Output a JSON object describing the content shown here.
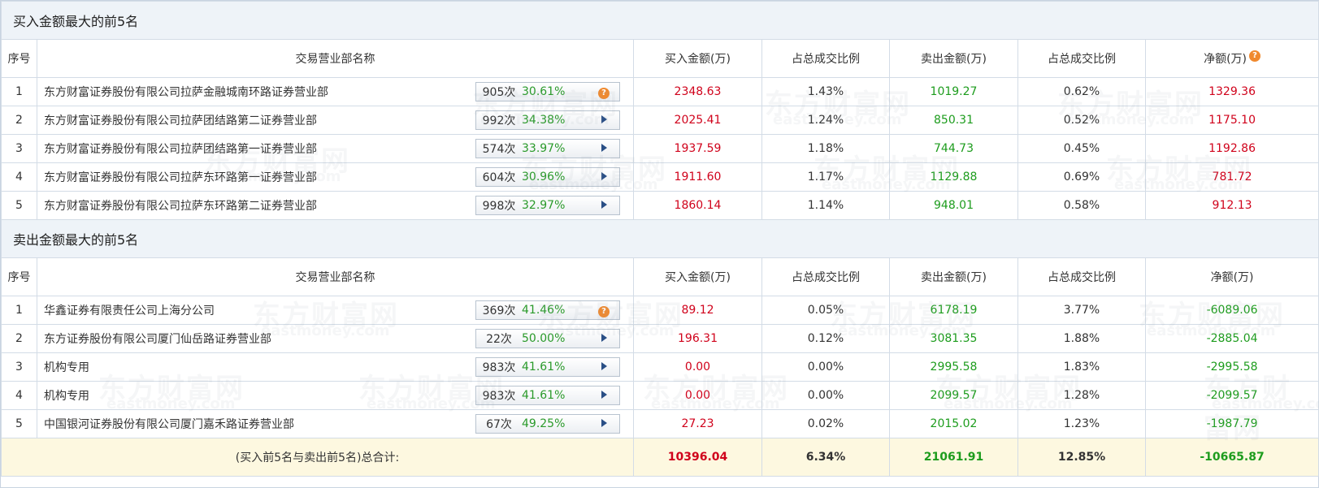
{
  "buy_section": {
    "title": "买入金额最大的前5名",
    "headers": [
      "序号",
      "交易营业部名称",
      "买入金额(万)",
      "占总成交比例",
      "卖出金额(万)",
      "占总成交比例",
      "净额(万)"
    ],
    "rows": [
      {
        "seq": "1",
        "name": "东方财富证券股份有限公司拉萨金融城南环路证券营业部",
        "count": "905次",
        "pct": "30.61%",
        "icon": "question-icon",
        "buy": "2348.63",
        "buy_ratio": "1.43%",
        "sell": "1019.27",
        "sell_ratio": "0.62%",
        "net": "1329.36"
      },
      {
        "seq": "2",
        "name": "东方财富证券股份有限公司拉萨团结路第二证券营业部",
        "count": "992次",
        "pct": "34.38%",
        "icon": "arrow-icon",
        "buy": "2025.41",
        "buy_ratio": "1.24%",
        "sell": "850.31",
        "sell_ratio": "0.52%",
        "net": "1175.10"
      },
      {
        "seq": "3",
        "name": "东方财富证券股份有限公司拉萨团结路第一证券营业部",
        "count": "574次",
        "pct": "33.97%",
        "icon": "arrow-icon",
        "buy": "1937.59",
        "buy_ratio": "1.18%",
        "sell": "744.73",
        "sell_ratio": "0.45%",
        "net": "1192.86"
      },
      {
        "seq": "4",
        "name": "东方财富证券股份有限公司拉萨东环路第一证券营业部",
        "count": "604次",
        "pct": "30.96%",
        "icon": "arrow-icon",
        "buy": "1911.60",
        "buy_ratio": "1.17%",
        "sell": "1129.88",
        "sell_ratio": "0.69%",
        "net": "781.72"
      },
      {
        "seq": "5",
        "name": "东方财富证券股份有限公司拉萨东环路第二证券营业部",
        "count": "998次",
        "pct": "32.97%",
        "icon": "arrow-icon",
        "buy": "1860.14",
        "buy_ratio": "1.14%",
        "sell": "948.01",
        "sell_ratio": "0.58%",
        "net": "912.13"
      }
    ]
  },
  "sell_section": {
    "title": "卖出金额最大的前5名",
    "headers": [
      "序号",
      "交易营业部名称",
      "买入金额(万)",
      "占总成交比例",
      "卖出金额(万)",
      "占总成交比例",
      "净额(万)"
    ],
    "rows": [
      {
        "seq": "1",
        "name": "华鑫证券有限责任公司上海分公司",
        "count": "369次",
        "pct": "41.46%",
        "icon": "question-icon",
        "buy": "89.12",
        "buy_ratio": "0.05%",
        "sell": "6178.19",
        "sell_ratio": "3.77%",
        "net": "-6089.06"
      },
      {
        "seq": "2",
        "name": "东方证券股份有限公司厦门仙岳路证券营业部",
        "count": "22次",
        "pct": "50.00%",
        "icon": "arrow-icon",
        "buy": "196.31",
        "buy_ratio": "0.12%",
        "sell": "3081.35",
        "sell_ratio": "1.88%",
        "net": "-2885.04"
      },
      {
        "seq": "3",
        "name": "机构专用",
        "count": "983次",
        "pct": "41.61%",
        "icon": "arrow-icon",
        "buy": "0.00",
        "buy_ratio": "0.00%",
        "sell": "2995.58",
        "sell_ratio": "1.83%",
        "net": "-2995.58"
      },
      {
        "seq": "4",
        "name": "机构专用",
        "count": "983次",
        "pct": "41.61%",
        "icon": "arrow-icon",
        "buy": "0.00",
        "buy_ratio": "0.00%",
        "sell": "2099.57",
        "sell_ratio": "1.28%",
        "net": "-2099.57"
      },
      {
        "seq": "5",
        "name": "中国银河证券股份有限公司厦门嘉禾路证券营业部",
        "count": "67次",
        "pct": "49.25%",
        "icon": "arrow-icon",
        "buy": "27.23",
        "buy_ratio": "0.02%",
        "sell": "2015.02",
        "sell_ratio": "1.23%",
        "net": "-1987.79"
      }
    ]
  },
  "total": {
    "label": "(买入前5名与卖出前5名)总合计:",
    "buy": "10396.04",
    "buy_ratio": "6.34%",
    "sell": "21061.91",
    "sell_ratio": "12.85%",
    "net": "-10665.87"
  },
  "net_header_icon": "question-icon",
  "watermark": {
    "cn": "东方财富网",
    "en": "eastmoney.com"
  },
  "colors": {
    "buy": "#d0021b",
    "sell": "#1d9c1d",
    "pct": "#2a9a2a",
    "icon_orange": "#f0892e",
    "arrow": "#2a4f86",
    "section_bg": "#eef3f8",
    "total_bg": "#fdf8e0"
  }
}
